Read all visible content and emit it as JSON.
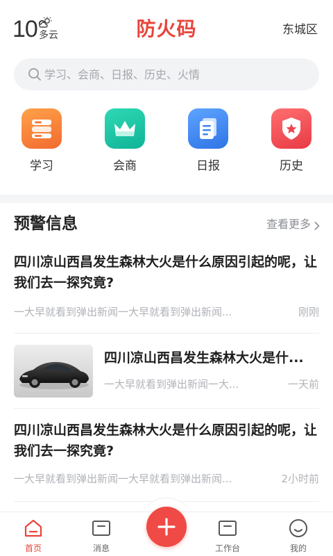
{
  "header": {
    "temperature": "10°",
    "weather": "多云",
    "weather_icon": "cloud-sun-icon",
    "app_title": "防火码",
    "district": "东城区"
  },
  "search": {
    "placeholder": "学习、会商、日报、历史、火情",
    "icon": "search-icon"
  },
  "categories": [
    {
      "label": "学习",
      "icon": "books-icon",
      "color": "#f57a3a"
    },
    {
      "label": "会商",
      "icon": "crown-icon",
      "color": "#16c2a3"
    },
    {
      "label": "日报",
      "icon": "document-icon",
      "color": "#3d86f0"
    },
    {
      "label": "历史",
      "icon": "shield-star-icon",
      "color": "#f0454c"
    }
  ],
  "section": {
    "title": "预警信息",
    "more": "查看更多"
  },
  "news": [
    {
      "title": "四川凉山西昌发生森林大火是什么原因引起的呢，让我们去一探究竟?",
      "summary": "一大早就看到弹出新闻一大早就看到弹出新闻...",
      "time": "刚刚"
    },
    {
      "title": "四川凉山西昌发生森林大火是什...",
      "summary": "一大早就看到弹出新闻一大...",
      "time": "一天前",
      "thumbnail": "sports-car-image"
    },
    {
      "title": "四川凉山西昌发生森林大火是什么原因引起的呢，让我们去一探究竟?",
      "summary": "一大早就看到弹出新闻一大早就看到弹出新闻...",
      "time": "2小时前"
    }
  ],
  "bottom_nav": [
    {
      "label": "首页",
      "icon": "home-icon",
      "active": true
    },
    {
      "label": "消息",
      "icon": "message-icon",
      "active": false
    },
    {
      "label": "",
      "icon": "plus-icon",
      "active": false
    },
    {
      "label": "工作台",
      "icon": "workbench-icon",
      "active": false
    },
    {
      "label": "我的",
      "icon": "profile-icon",
      "active": false
    }
  ],
  "colors": {
    "brand": "#e8453c",
    "fab": "#ef4a45",
    "muted_text": "#b0b3b8"
  }
}
